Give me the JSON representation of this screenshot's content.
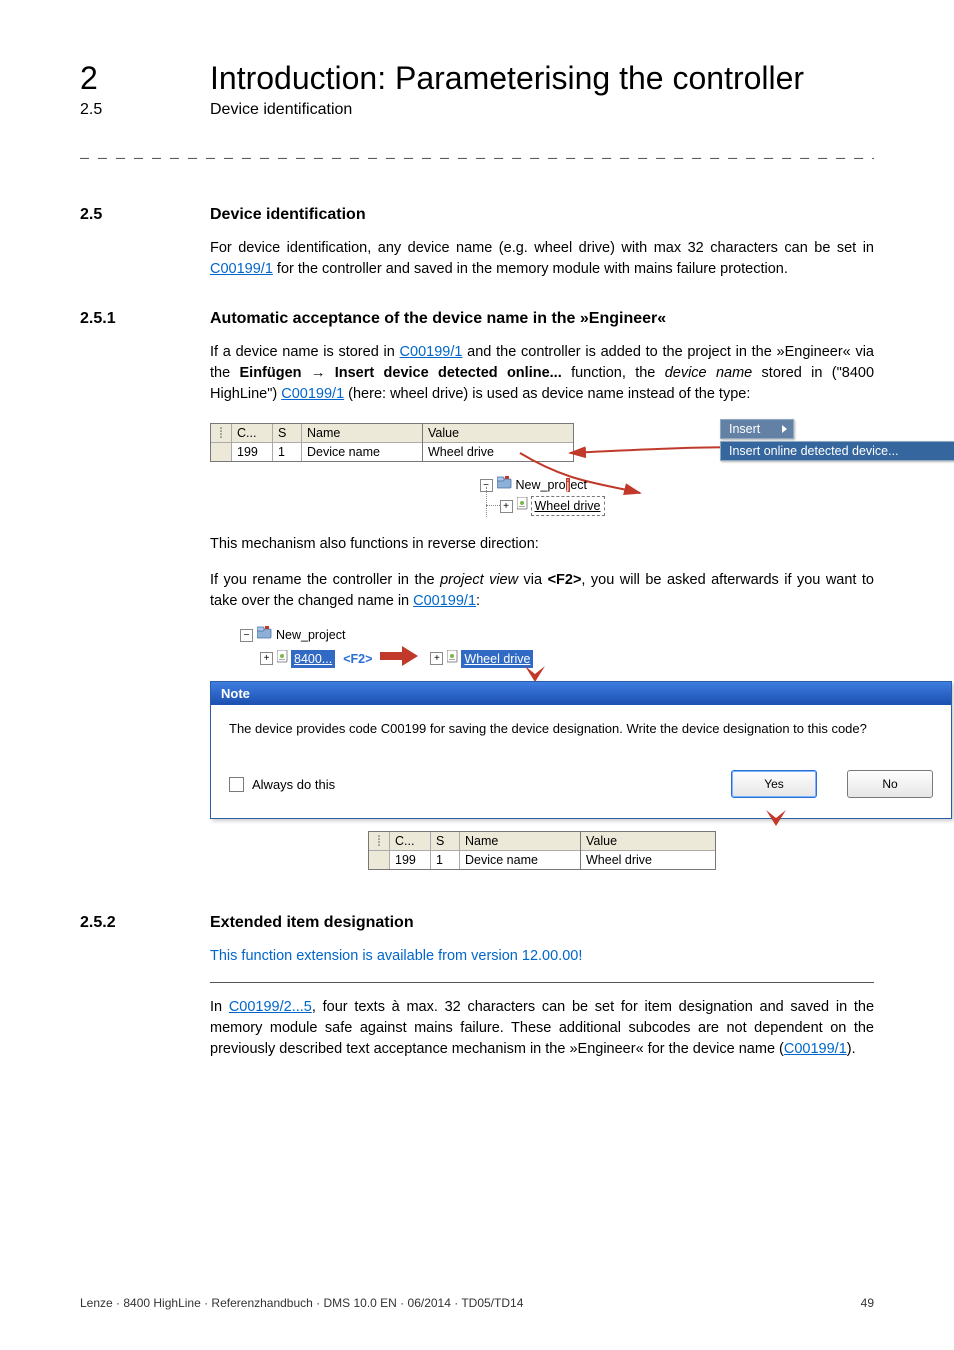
{
  "header": {
    "chapter_num": "2",
    "chapter_title": "Introduction: Parameterising the controller",
    "sub_num": "2.5",
    "sub_title": "Device identification"
  },
  "dash_sep": "_ _ _ _ _ _ _ _ _ _ _ _ _ _ _ _ _ _ _ _ _ _ _ _ _ _ _ _ _ _ _ _ _ _ _ _ _ _ _ _ _ _ _ _ _ _ _ _ _ _ _ _ _ _ _ _ _ _ _ _ _ _ _ _",
  "s25": {
    "num": "2.5",
    "title": "Device identification",
    "para_a": "For device identification, any device name (e.g. wheel drive) with max 32 characters can be set in ",
    "link1": "C00199/1",
    "para_b": " for the controller and saved in the memory module with mains failure protection."
  },
  "s251": {
    "num": "2.5.1",
    "title": "Automatic acceptance of the device name in the »Engineer«",
    "p1a": "If a device name is stored in ",
    "p1link": "C00199/1",
    "p1b": " and the controller is added to the project in the »Engineer« via the ",
    "p1_bold1": "Einfügen",
    "p1_arrow": " → ",
    "p1_bold2": "Insert device detected online...",
    "p1c": " function, the ",
    "p1_it": "device name",
    "p1d": "  stored in (\"8400 HighLine\")  ",
    "p1link2": "C00199/1",
    "p1e": " (here: wheel drive) is used as device name instead of the type:",
    "grid1": {
      "h_c": "C...",
      "h_s": "S",
      "h_n": "Name",
      "h_v": "Value",
      "r_c": "199",
      "r_s": "1",
      "r_n": "Device name",
      "r_v": "Wheel drive"
    },
    "menu1": "Insert",
    "menu2": "Insert online detected device...",
    "tree_mid": {
      "proj": "New_project",
      "dev": "Wheel drive"
    },
    "p2a": "This mechanism also functions in reverse direction:",
    "p2b_a": "If you rename the controller in the ",
    "p2b_it": "project view",
    "p2b_b": " via ",
    "p2b_bold": "<F2>",
    "p2b_c": ", you will be asked afterwards if you want to take over the changed name in ",
    "p2b_link": "C00199/1",
    "p2b_d": ":",
    "tree2": {
      "proj": "New_project",
      "code": "8400...",
      "f2": "<F2>",
      "dev": "Wheel drive"
    },
    "dialog": {
      "title": "Note",
      "msg": "The device provides code C00199 for saving the device designation. Write the device designation to this code?",
      "chk": "Always do this",
      "yes": "Yes",
      "no": "No"
    },
    "grid2": {
      "h_c": "C...",
      "h_s": "S",
      "h_n": "Name",
      "h_v": "Value",
      "r_c": "199",
      "r_s": "1",
      "r_n": "Device name",
      "r_v": "Wheel drive"
    }
  },
  "s252": {
    "num": "2.5.2",
    "title": "Extended item designation",
    "blue": "This function extension is available from version 12.00.00!",
    "p_a": "In ",
    "p_link1": "C00199/2...5",
    "p_b": ", four texts à max. 32 characters can be set for item designation and saved in the memory module safe against mains failure. These additional subcodes are not dependent on the previously described text acceptance mechanism in the »Engineer« for the device name (",
    "p_link2": "C00199/1",
    "p_c": ")."
  },
  "footer": {
    "left": "Lenze · 8400 HighLine · Referenzhandbuch · DMS 10.0 EN · 06/2014 · TD05/TD14",
    "right": "49"
  }
}
